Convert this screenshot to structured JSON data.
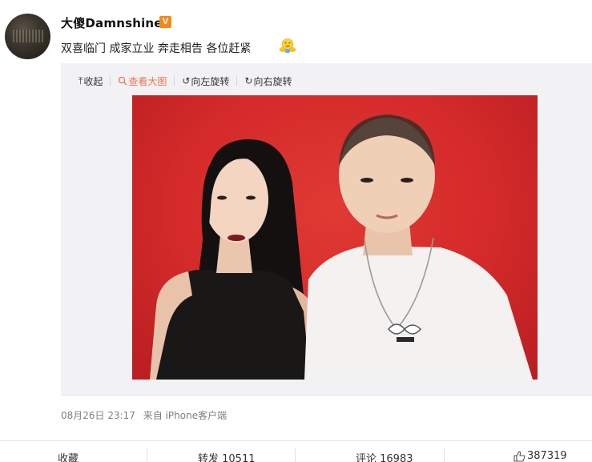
{
  "post": {
    "username": "大傻Damnshine",
    "badge": "V",
    "text": "双喜临门 成家立业 奔走相告 各位赶紧",
    "emoji": "hug-emoji",
    "timestamp": "08月26日 23:17",
    "source": "来自 iPhone客户端"
  },
  "toolbar": {
    "collapse": "收起",
    "view_large": "查看大图",
    "rotate_left": "向左旋转",
    "rotate_right": "向右旋转"
  },
  "actions": {
    "favorite": "收藏",
    "repost": "转发 10511",
    "comment": "评论 16983",
    "like": "387319"
  },
  "colors": {
    "accent": "#eb7350",
    "badge": "#f28a1a",
    "photo_background": "#d42a2a"
  }
}
